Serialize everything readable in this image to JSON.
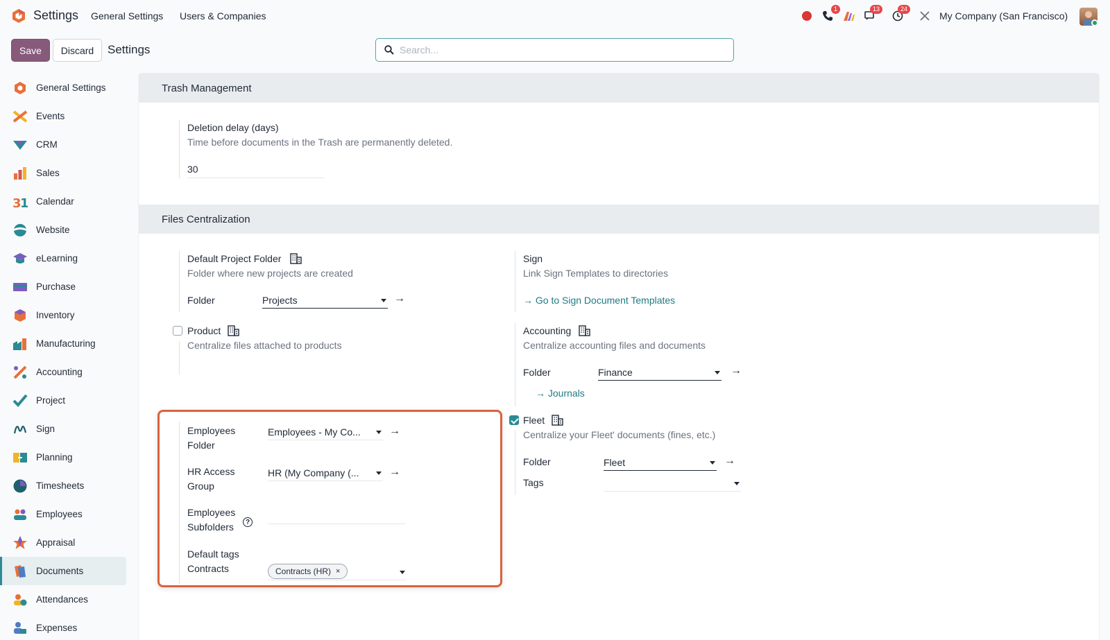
{
  "topbar": {
    "app_title": "Settings",
    "menu": [
      "General Settings",
      "Users & Companies"
    ],
    "badges": {
      "phone": "1",
      "chat": "13",
      "activity": "24"
    },
    "company": "My Company (San Francisco)"
  },
  "control_panel": {
    "save_label": "Save",
    "discard_label": "Discard",
    "title": "Settings",
    "search_placeholder": "Search..."
  },
  "sidebar": {
    "items": [
      {
        "label": "General Settings",
        "icon": "general-settings-icon"
      },
      {
        "label": "Events",
        "icon": "events-icon"
      },
      {
        "label": "CRM",
        "icon": "crm-icon"
      },
      {
        "label": "Sales",
        "icon": "sales-icon"
      },
      {
        "label": "Calendar",
        "icon": "calendar-icon"
      },
      {
        "label": "Website",
        "icon": "website-icon"
      },
      {
        "label": "eLearning",
        "icon": "elearning-icon"
      },
      {
        "label": "Purchase",
        "icon": "purchase-icon"
      },
      {
        "label": "Inventory",
        "icon": "inventory-icon"
      },
      {
        "label": "Manufacturing",
        "icon": "manufacturing-icon"
      },
      {
        "label": "Accounting",
        "icon": "accounting-icon"
      },
      {
        "label": "Project",
        "icon": "project-icon"
      },
      {
        "label": "Sign",
        "icon": "sign-icon"
      },
      {
        "label": "Planning",
        "icon": "planning-icon"
      },
      {
        "label": "Timesheets",
        "icon": "timesheets-icon"
      },
      {
        "label": "Employees",
        "icon": "employees-icon"
      },
      {
        "label": "Appraisal",
        "icon": "appraisal-icon"
      },
      {
        "label": "Documents",
        "icon": "documents-icon"
      },
      {
        "label": "Attendances",
        "icon": "attendances-icon"
      },
      {
        "label": "Expenses",
        "icon": "expenses-icon"
      }
    ],
    "active": "Documents"
  },
  "trash": {
    "header": "Trash Management",
    "label": "Deletion delay (days)",
    "description": "Time before documents in the Trash are permanently deleted.",
    "value": "30"
  },
  "files": {
    "header": "Files Centralization",
    "project": {
      "label": "Default Project Folder",
      "description": "Folder where new projects are created",
      "folder_label": "Folder",
      "folder_value": "Projects"
    },
    "sign": {
      "label": "Sign",
      "description": "Link Sign Templates to directories",
      "link": "Go to Sign Document Templates"
    },
    "product": {
      "label": "Product",
      "description": "Centralize files attached to products",
      "checked": false
    },
    "accounting": {
      "label": "Accounting",
      "description": "Centralize accounting files and documents",
      "folder_label": "Folder",
      "folder_value": "Finance",
      "link": "Journals"
    },
    "employees": {
      "folder_label_1": "Employees",
      "folder_label_2": "Folder",
      "folder_value": "Employees - My Co...",
      "hr_label_1": "HR Access",
      "hr_label_2": "Group",
      "hr_value": "HR (My Company (...",
      "subfolders_label_1": "Employees",
      "subfolders_label_2": "Subfolders",
      "tags_label_1": "Default tags",
      "tags_label_2": "Contracts",
      "tag_value": "Contracts (HR)"
    },
    "fleet": {
      "label": "Fleet",
      "description": "Centralize your Fleet' documents (fines, etc.)",
      "checked": true,
      "folder_label": "Folder",
      "folder_value": "Fleet",
      "tags_label": "Tags"
    }
  },
  "colors": {
    "primary": "#875a7b",
    "accent": "#2b8a93",
    "highlight": "#d9633b",
    "badge": "#e5484d"
  }
}
